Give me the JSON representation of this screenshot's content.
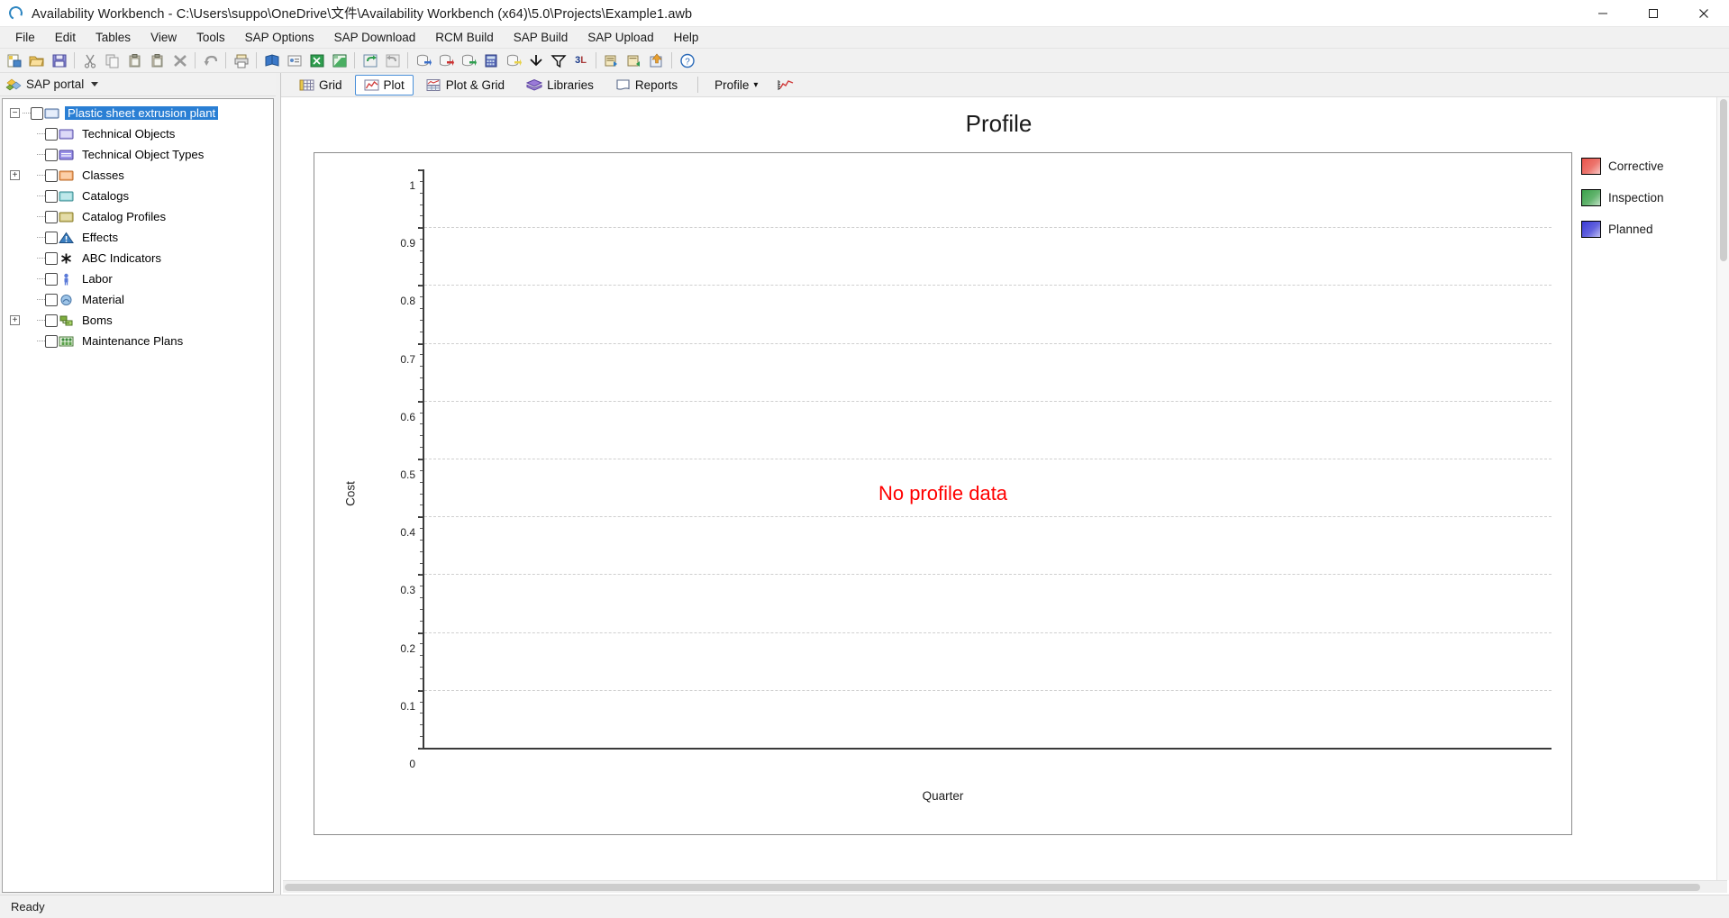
{
  "window": {
    "title": "Availability Workbench - C:\\Users\\suppo\\OneDrive\\文件\\Availability Workbench (x64)\\5.0\\Projects\\Example1.awb",
    "app_icon": "app-logo-icon",
    "minimize_label": "–",
    "maximize_label": "☐",
    "close_label": "✕"
  },
  "menubar": {
    "items": [
      {
        "label": "File"
      },
      {
        "label": "Edit"
      },
      {
        "label": "Tables"
      },
      {
        "label": "View"
      },
      {
        "label": "Tools"
      },
      {
        "label": "SAP Options"
      },
      {
        "label": "SAP Download"
      },
      {
        "label": "RCM Build"
      },
      {
        "label": "SAP Build"
      },
      {
        "label": "SAP Upload"
      },
      {
        "label": "Help"
      }
    ]
  },
  "toolbar": {
    "buttons": [
      {
        "name": "new-project-icon",
        "kind": "new"
      },
      {
        "name": "open-project-icon",
        "kind": "open"
      },
      {
        "name": "save-project-icon",
        "kind": "save"
      },
      {
        "name": "separator",
        "kind": "sep"
      },
      {
        "name": "cut-icon",
        "kind": "cut"
      },
      {
        "name": "copy-icon",
        "kind": "copy"
      },
      {
        "name": "paste-icon",
        "kind": "paste"
      },
      {
        "name": "paste-special-icon",
        "kind": "paste"
      },
      {
        "name": "delete-icon",
        "kind": "delete"
      },
      {
        "name": "separator",
        "kind": "sep"
      },
      {
        "name": "undo-icon",
        "kind": "undo"
      },
      {
        "name": "separator",
        "kind": "sep"
      },
      {
        "name": "print-icon",
        "kind": "print"
      },
      {
        "name": "separator",
        "kind": "sep"
      },
      {
        "name": "book-blue-icon",
        "kind": "book"
      },
      {
        "name": "report-card-icon",
        "kind": "card"
      },
      {
        "name": "excel-export-icon",
        "kind": "excel"
      },
      {
        "name": "excel-import-icon",
        "kind": "excel2"
      },
      {
        "name": "separator",
        "kind": "sep"
      },
      {
        "name": "refresh-in-icon",
        "kind": "refresh-in"
      },
      {
        "name": "refresh-out-icon",
        "kind": "refresh-out"
      },
      {
        "name": "separator",
        "kind": "sep"
      },
      {
        "name": "database-blue-icon",
        "kind": "db-blue"
      },
      {
        "name": "database-red-icon",
        "kind": "db-red"
      },
      {
        "name": "database-green-icon",
        "kind": "db-green"
      },
      {
        "name": "calculator-icon",
        "kind": "calc"
      },
      {
        "name": "database-yellow-icon",
        "kind": "db-yellow"
      },
      {
        "name": "collapse-arrows-icon",
        "kind": "collapse"
      },
      {
        "name": "filter-icon",
        "kind": "filter"
      },
      {
        "name": "3d-view-icon",
        "kind": "threed"
      },
      {
        "name": "separator",
        "kind": "sep"
      },
      {
        "name": "sap-export-icon",
        "kind": "sap-out"
      },
      {
        "name": "sap-import-icon",
        "kind": "sap-in"
      },
      {
        "name": "sap-upload-icon",
        "kind": "sap-up"
      },
      {
        "name": "separator",
        "kind": "sep"
      },
      {
        "name": "help-icon",
        "kind": "help"
      }
    ]
  },
  "sidebar": {
    "portal": {
      "label": "SAP portal",
      "icon": "sap-portal-icon"
    },
    "tree": [
      {
        "label": "Plastic sheet extrusion plant",
        "icon": "plant-icon",
        "depth": 0,
        "expander": "minus",
        "selected": true,
        "checked": false
      },
      {
        "label": "Technical Objects",
        "icon": "technical-objects-icon",
        "depth": 1,
        "expander": "none",
        "selected": false,
        "checked": false
      },
      {
        "label": "Technical Object Types",
        "icon": "technical-object-types-icon",
        "depth": 1,
        "expander": "none",
        "selected": false,
        "checked": false
      },
      {
        "label": "Classes",
        "icon": "classes-icon",
        "depth": 1,
        "expander": "plus",
        "selected": false,
        "checked": false
      },
      {
        "label": "Catalogs",
        "icon": "catalogs-icon",
        "depth": 1,
        "expander": "none",
        "selected": false,
        "checked": false
      },
      {
        "label": "Catalog Profiles",
        "icon": "catalog-profiles-icon",
        "depth": 1,
        "expander": "none",
        "selected": false,
        "checked": false
      },
      {
        "label": "Effects",
        "icon": "effects-warning-icon",
        "depth": 1,
        "expander": "none",
        "selected": false,
        "checked": false
      },
      {
        "label": "ABC Indicators",
        "icon": "abc-indicators-icon",
        "depth": 1,
        "expander": "none",
        "selected": false,
        "checked": false
      },
      {
        "label": "Labor",
        "icon": "labor-person-icon",
        "depth": 1,
        "expander": "none",
        "selected": false,
        "checked": false
      },
      {
        "label": "Material",
        "icon": "material-icon",
        "depth": 1,
        "expander": "none",
        "selected": false,
        "checked": false
      },
      {
        "label": "Boms",
        "icon": "boms-icon",
        "depth": 1,
        "expander": "plus",
        "selected": false,
        "checked": false
      },
      {
        "label": "Maintenance Plans",
        "icon": "maintenance-plans-icon",
        "depth": 1,
        "expander": "none",
        "selected": false,
        "checked": false
      }
    ]
  },
  "tabstrip": {
    "tabs": [
      {
        "label": "Grid",
        "icon": "grid-icon",
        "active": false
      },
      {
        "label": "Plot",
        "icon": "plot-icon",
        "active": true
      },
      {
        "label": "Plot & Grid",
        "icon": "plot-grid-icon",
        "active": false
      },
      {
        "label": "Libraries",
        "icon": "libraries-book-icon",
        "active": false
      },
      {
        "label": "Reports",
        "icon": "reports-icon",
        "active": false
      }
    ],
    "profile_dropdown": {
      "label": "Profile",
      "caret": "▾",
      "icon": "profile-chart-icon"
    }
  },
  "statusbar": {
    "text": "Ready"
  },
  "chart_data": {
    "type": "line",
    "title": "Profile",
    "xlabel": "Quarter",
    "ylabel": "Cost",
    "empty_message": "No profile data",
    "empty_message_color": "#ff0000",
    "ylim": [
      0,
      1
    ],
    "yticks": [
      "0",
      "0.1",
      "0.2",
      "0.3",
      "0.4",
      "0.5",
      "0.6",
      "0.7",
      "0.8",
      "0.9",
      "1"
    ],
    "ytick_values": [
      0,
      0.1,
      0.2,
      0.3,
      0.4,
      0.5,
      0.6,
      0.7,
      0.8,
      0.9,
      1
    ],
    "xticks": [],
    "grid": true,
    "grid_style": "dashed",
    "grid_color": "#cfcfcf",
    "legend_position": "right",
    "series": [
      {
        "name": "Corrective",
        "color": "#e8534a",
        "values": []
      },
      {
        "name": "Inspection",
        "color": "#3ba14a",
        "values": []
      },
      {
        "name": "Planned",
        "color": "#3b3bd6",
        "values": []
      }
    ]
  }
}
